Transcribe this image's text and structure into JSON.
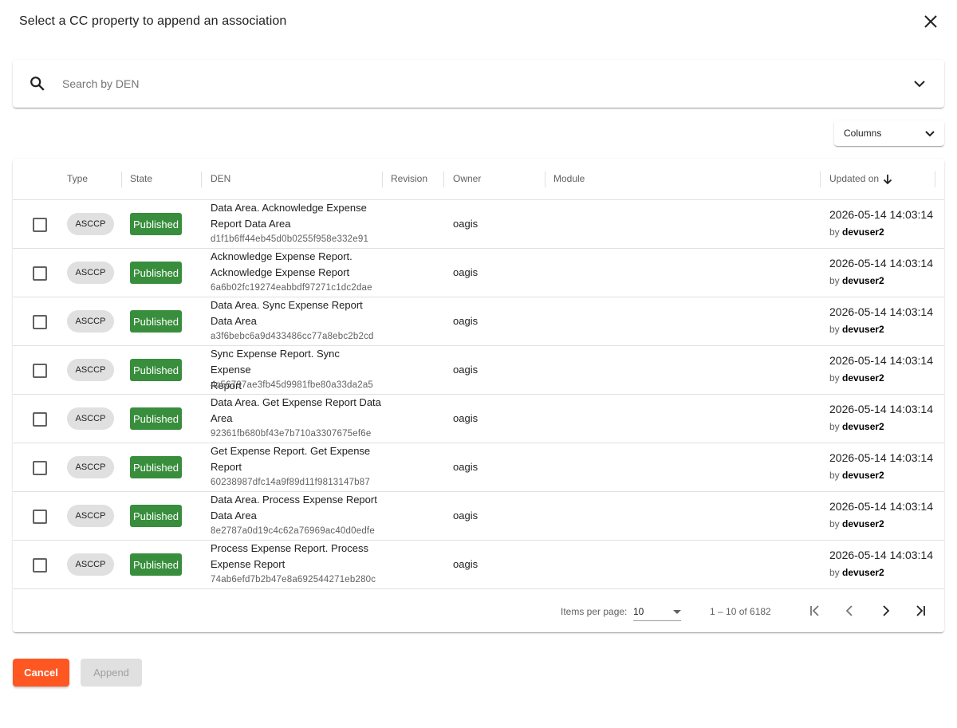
{
  "dialog": {
    "title": "Select a CC property to append an association"
  },
  "search": {
    "placeholder": "Search by DEN"
  },
  "columns_button": {
    "label": "Columns"
  },
  "table": {
    "headers": {
      "type": "Type",
      "state": "State",
      "den": "DEN",
      "revision": "Revision",
      "owner": "Owner",
      "module": "Module",
      "updated_on": "Updated on"
    },
    "sort": {
      "column": "updated_on",
      "direction": "descending"
    },
    "rows": [
      {
        "type": "ASCCP",
        "state": "Published",
        "den_line1": "Data Area. Acknowledge Expense",
        "den_line2": "Report Data Area",
        "den_hash": "d1f1b6ff44eb45d0b0255f958e332e91",
        "owner": "oagis",
        "updated": "2026-05-14 14:03:14",
        "by_prefix": "by",
        "by_user": "devuser2"
      },
      {
        "type": "ASCCP",
        "state": "Published",
        "den_line1": "Acknowledge Expense Report.",
        "den_line2": "Acknowledge Expense Report",
        "den_hash": "6a6b02fc19274eabbdf97271c1dc2dae",
        "owner": "oagis",
        "updated": "2026-05-14 14:03:14",
        "by_prefix": "by",
        "by_user": "devuser2"
      },
      {
        "type": "ASCCP",
        "state": "Published",
        "den_line1": "Data Area. Sync Expense Report",
        "den_line2": "Data Area",
        "den_hash": "a3f6bebc6a9d433486cc77a8ebc2b2cd",
        "owner": "oagis",
        "updated": "2026-05-14 14:03:14",
        "by_prefix": "by",
        "by_user": "devuser2"
      },
      {
        "type": "ASCCP",
        "state": "Published",
        "den_line1": "Sync Expense Report. Sync Expense",
        "den_line2": "Report",
        "den_hash": "4c56797ae3fb45d9981fbe80a33da2a5",
        "owner": "oagis",
        "updated": "2026-05-14 14:03:14",
        "by_prefix": "by",
        "by_user": "devuser2"
      },
      {
        "type": "ASCCP",
        "state": "Published",
        "den_line1": "Data Area. Get Expense Report Data",
        "den_line2": "Area",
        "den_hash": "92361fb680bf43e7b710a3307675ef6e",
        "owner": "oagis",
        "updated": "2026-05-14 14:03:14",
        "by_prefix": "by",
        "by_user": "devuser2"
      },
      {
        "type": "ASCCP",
        "state": "Published",
        "den_line1": "Get Expense Report. Get Expense",
        "den_line2": "Report",
        "den_hash": "60238987dfc14a9f89d11f9813147b87",
        "owner": "oagis",
        "updated": "2026-05-14 14:03:14",
        "by_prefix": "by",
        "by_user": "devuser2"
      },
      {
        "type": "ASCCP",
        "state": "Published",
        "den_line1": "Data Area. Process Expense Report",
        "den_line2": "Data Area",
        "den_hash": "8e2787a0d19c4c62a76969ac40d0edfe",
        "owner": "oagis",
        "updated": "2026-05-14 14:03:14",
        "by_prefix": "by",
        "by_user": "devuser2"
      },
      {
        "type": "ASCCP",
        "state": "Published",
        "den_line1": "Process Expense Report. Process",
        "den_line2": "Expense Report",
        "den_hash": "74ab6efd7b2b47e8a692544271eb280c",
        "owner": "oagis",
        "updated": "2026-05-14 14:03:14",
        "by_prefix": "by",
        "by_user": "devuser2"
      }
    ]
  },
  "paginator": {
    "items_per_page_label": "Items per page:",
    "items_per_page_value": "10",
    "range": "1 – 10 of 6182"
  },
  "actions": {
    "cancel_label": "Cancel",
    "append_label": "Append"
  },
  "colors": {
    "published": "#388e3c",
    "cancel": "#ff5722",
    "chip": "#e0e0e0"
  }
}
